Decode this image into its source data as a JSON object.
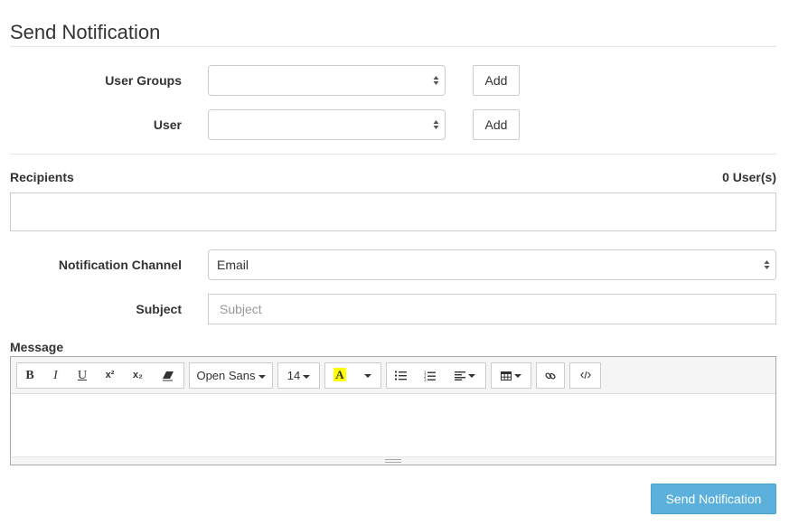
{
  "page": {
    "title": "Send Notification"
  },
  "user_groups": {
    "label": "User Groups",
    "value": "",
    "add_label": "Add"
  },
  "user": {
    "label": "User",
    "value": "",
    "add_label": "Add"
  },
  "recipients": {
    "label": "Recipients",
    "count": "0 User(s)"
  },
  "channel": {
    "label": "Notification Channel",
    "value": "Email"
  },
  "subject": {
    "label": "Subject",
    "placeholder": "Subject",
    "value": ""
  },
  "message": {
    "label": "Message",
    "toolbar": {
      "bold": "B",
      "italic": "I",
      "underline": "U",
      "superscript": "x²",
      "subscript": "x₂",
      "font_family": "Open Sans",
      "font_size": "14",
      "color_letter": "A"
    },
    "highlight_color": "#ffff00"
  },
  "submit": {
    "label": "Send Notification"
  },
  "colors": {
    "primary_button": "#5bb0dc",
    "border": "#cccccc"
  }
}
